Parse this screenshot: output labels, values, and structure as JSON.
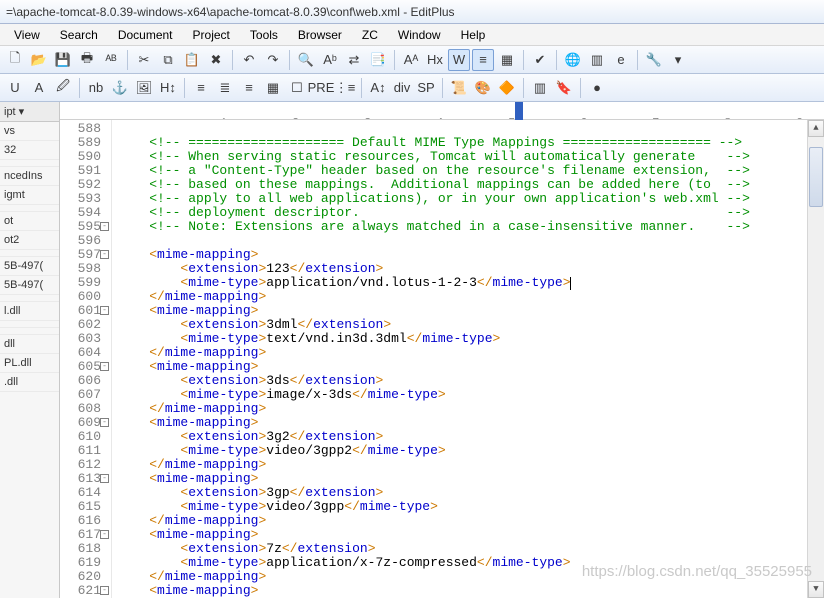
{
  "title": "=\\apache-tomcat-8.0.39-windows-x64\\apache-tomcat-8.0.39\\conf\\web.xml - EditPlus",
  "menu": [
    "View",
    "Search",
    "Document",
    "Project",
    "Tools",
    "Browser",
    "ZC",
    "Window",
    "Help"
  ],
  "sidebar": {
    "tab": "ipt ▾",
    "items": [
      "vs",
      "32",
      "",
      "ncedIns",
      "igmt",
      "",
      "ot",
      "ot2",
      "",
      "5B-497(",
      "5B-497(",
      "",
      "l.dll",
      "",
      "",
      "dll",
      "PL.dll",
      ".dll"
    ]
  },
  "ruler": "----+----1----+----2----+----3----+----4----+----5----+----6----+----7----+----8----+----9----+----0-",
  "ruler_mark_col": 56,
  "watermark": "https://blog.csdn.net/qq_35525955",
  "lines": [
    {
      "n": 588,
      "c": ""
    },
    {
      "n": 589,
      "c": "    <!-- ==================== Default MIME Type Mappings =================== -->",
      "cls": "cm"
    },
    {
      "n": 590,
      "c": "    <!-- When serving static resources, Tomcat will automatically generate    -->",
      "cls": "cm"
    },
    {
      "n": 591,
      "c": "    <!-- a \"Content-Type\" header based on the resource's filename extension,  -->",
      "cls": "cm"
    },
    {
      "n": 592,
      "c": "    <!-- based on these mappings.  Additional mappings can be added here (to  -->",
      "cls": "cm"
    },
    {
      "n": 593,
      "c": "    <!-- apply to all web applications), or in your own application's web.xml -->",
      "cls": "cm"
    },
    {
      "n": 594,
      "c": "    <!-- deployment descriptor.                                               -->",
      "cls": "cm"
    },
    {
      "n": 595,
      "c": "    <!-- Note: Extensions are always matched in a case-insensitive manner.    -->",
      "cls": "cm",
      "fold": "-"
    },
    {
      "n": 596,
      "c": ""
    },
    {
      "n": 597,
      "seg": [
        [
          "    ",
          ""
        ],
        [
          "<",
          "br"
        ],
        [
          "mime-mapping",
          "tag"
        ],
        [
          ">",
          "br"
        ]
      ],
      "fold": "-"
    },
    {
      "n": 598,
      "seg": [
        [
          "        ",
          ""
        ],
        [
          "<",
          "br"
        ],
        [
          "extension",
          "tag"
        ],
        [
          ">",
          "br"
        ],
        [
          "123",
          "txt"
        ],
        [
          "</",
          "br"
        ],
        [
          "extension",
          "tag"
        ],
        [
          ">",
          "br"
        ]
      ]
    },
    {
      "n": 599,
      "seg": [
        [
          "        ",
          ""
        ],
        [
          "<",
          "br"
        ],
        [
          "mime-type",
          "tag"
        ],
        [
          ">",
          "br"
        ],
        [
          "application/vnd.lotus-1-2-3",
          "txt"
        ],
        [
          "</",
          "br"
        ],
        [
          "mime-type",
          "tag"
        ],
        [
          ">",
          "br"
        ]
      ],
      "caret": true,
      "arrow": true
    },
    {
      "n": 600,
      "seg": [
        [
          "    ",
          ""
        ],
        [
          "</",
          "br"
        ],
        [
          "mime-mapping",
          "tag"
        ],
        [
          ">",
          "br"
        ]
      ]
    },
    {
      "n": 601,
      "seg": [
        [
          "    ",
          ""
        ],
        [
          "<",
          "br"
        ],
        [
          "mime-mapping",
          "tag"
        ],
        [
          ">",
          "br"
        ]
      ],
      "fold": "-"
    },
    {
      "n": 602,
      "seg": [
        [
          "        ",
          ""
        ],
        [
          "<",
          "br"
        ],
        [
          "extension",
          "tag"
        ],
        [
          ">",
          "br"
        ],
        [
          "3dml",
          "txt"
        ],
        [
          "</",
          "br"
        ],
        [
          "extension",
          "tag"
        ],
        [
          ">",
          "br"
        ]
      ]
    },
    {
      "n": 603,
      "seg": [
        [
          "        ",
          ""
        ],
        [
          "<",
          "br"
        ],
        [
          "mime-type",
          "tag"
        ],
        [
          ">",
          "br"
        ],
        [
          "text/vnd.in3d.3dml",
          "txt"
        ],
        [
          "</",
          "br"
        ],
        [
          "mime-type",
          "tag"
        ],
        [
          ">",
          "br"
        ]
      ]
    },
    {
      "n": 604,
      "seg": [
        [
          "    ",
          ""
        ],
        [
          "</",
          "br"
        ],
        [
          "mime-mapping",
          "tag"
        ],
        [
          ">",
          "br"
        ]
      ]
    },
    {
      "n": 605,
      "seg": [
        [
          "    ",
          ""
        ],
        [
          "<",
          "br"
        ],
        [
          "mime-mapping",
          "tag"
        ],
        [
          ">",
          "br"
        ]
      ],
      "fold": "-"
    },
    {
      "n": 606,
      "seg": [
        [
          "        ",
          ""
        ],
        [
          "<",
          "br"
        ],
        [
          "extension",
          "tag"
        ],
        [
          ">",
          "br"
        ],
        [
          "3ds",
          "txt"
        ],
        [
          "</",
          "br"
        ],
        [
          "extension",
          "tag"
        ],
        [
          ">",
          "br"
        ]
      ]
    },
    {
      "n": 607,
      "seg": [
        [
          "        ",
          ""
        ],
        [
          "<",
          "br"
        ],
        [
          "mime-type",
          "tag"
        ],
        [
          ">",
          "br"
        ],
        [
          "image/x-3ds",
          "txt"
        ],
        [
          "</",
          "br"
        ],
        [
          "mime-type",
          "tag"
        ],
        [
          ">",
          "br"
        ]
      ]
    },
    {
      "n": 608,
      "seg": [
        [
          "    ",
          ""
        ],
        [
          "</",
          "br"
        ],
        [
          "mime-mapping",
          "tag"
        ],
        [
          ">",
          "br"
        ]
      ]
    },
    {
      "n": 609,
      "seg": [
        [
          "    ",
          ""
        ],
        [
          "<",
          "br"
        ],
        [
          "mime-mapping",
          "tag"
        ],
        [
          ">",
          "br"
        ]
      ],
      "fold": "-"
    },
    {
      "n": 610,
      "seg": [
        [
          "        ",
          ""
        ],
        [
          "<",
          "br"
        ],
        [
          "extension",
          "tag"
        ],
        [
          ">",
          "br"
        ],
        [
          "3g2",
          "txt"
        ],
        [
          "</",
          "br"
        ],
        [
          "extension",
          "tag"
        ],
        [
          ">",
          "br"
        ]
      ]
    },
    {
      "n": 611,
      "seg": [
        [
          "        ",
          ""
        ],
        [
          "<",
          "br"
        ],
        [
          "mime-type",
          "tag"
        ],
        [
          ">",
          "br"
        ],
        [
          "video/3gpp2",
          "txt"
        ],
        [
          "</",
          "br"
        ],
        [
          "mime-type",
          "tag"
        ],
        [
          ">",
          "br"
        ]
      ]
    },
    {
      "n": 612,
      "seg": [
        [
          "    ",
          ""
        ],
        [
          "</",
          "br"
        ],
        [
          "mime-mapping",
          "tag"
        ],
        [
          ">",
          "br"
        ]
      ]
    },
    {
      "n": 613,
      "seg": [
        [
          "    ",
          ""
        ],
        [
          "<",
          "br"
        ],
        [
          "mime-mapping",
          "tag"
        ],
        [
          ">",
          "br"
        ]
      ],
      "fold": "-"
    },
    {
      "n": 614,
      "seg": [
        [
          "        ",
          ""
        ],
        [
          "<",
          "br"
        ],
        [
          "extension",
          "tag"
        ],
        [
          ">",
          "br"
        ],
        [
          "3gp",
          "txt"
        ],
        [
          "</",
          "br"
        ],
        [
          "extension",
          "tag"
        ],
        [
          ">",
          "br"
        ]
      ]
    },
    {
      "n": 615,
      "seg": [
        [
          "        ",
          ""
        ],
        [
          "<",
          "br"
        ],
        [
          "mime-type",
          "tag"
        ],
        [
          ">",
          "br"
        ],
        [
          "video/3gpp",
          "txt"
        ],
        [
          "</",
          "br"
        ],
        [
          "mime-type",
          "tag"
        ],
        [
          ">",
          "br"
        ]
      ]
    },
    {
      "n": 616,
      "seg": [
        [
          "    ",
          ""
        ],
        [
          "</",
          "br"
        ],
        [
          "mime-mapping",
          "tag"
        ],
        [
          ">",
          "br"
        ]
      ]
    },
    {
      "n": 617,
      "seg": [
        [
          "    ",
          ""
        ],
        [
          "<",
          "br"
        ],
        [
          "mime-mapping",
          "tag"
        ],
        [
          ">",
          "br"
        ]
      ],
      "fold": "-"
    },
    {
      "n": 618,
      "seg": [
        [
          "        ",
          ""
        ],
        [
          "<",
          "br"
        ],
        [
          "extension",
          "tag"
        ],
        [
          ">",
          "br"
        ],
        [
          "7z",
          "txt"
        ],
        [
          "</",
          "br"
        ],
        [
          "extension",
          "tag"
        ],
        [
          ">",
          "br"
        ]
      ]
    },
    {
      "n": 619,
      "seg": [
        [
          "        ",
          ""
        ],
        [
          "<",
          "br"
        ],
        [
          "mime-type",
          "tag"
        ],
        [
          ">",
          "br"
        ],
        [
          "application/x-7z-compressed",
          "txt"
        ],
        [
          "</",
          "br"
        ],
        [
          "mime-type",
          "tag"
        ],
        [
          ">",
          "br"
        ]
      ]
    },
    {
      "n": 620,
      "seg": [
        [
          "    ",
          ""
        ],
        [
          "</",
          "br"
        ],
        [
          "mime-mapping",
          "tag"
        ],
        [
          ">",
          "br"
        ]
      ]
    },
    {
      "n": 621,
      "seg": [
        [
          "    ",
          ""
        ],
        [
          "<",
          "br"
        ],
        [
          "mime-mapping",
          "tag"
        ],
        [
          ">",
          "br"
        ]
      ],
      "fold": "-"
    }
  ],
  "toolbar1": [
    {
      "name": "new-file-icon",
      "g": "🗋"
    },
    {
      "name": "open-icon",
      "g": "📂"
    },
    {
      "name": "save-icon",
      "g": "💾"
    },
    {
      "name": "print-icon",
      "g": "🖶"
    },
    {
      "name": "spell-icon",
      "g": "ᴬᴮ"
    },
    {
      "sep": true
    },
    {
      "name": "cut-icon",
      "g": "✂"
    },
    {
      "name": "copy-icon",
      "g": "⧉"
    },
    {
      "name": "paste-icon",
      "g": "📋"
    },
    {
      "name": "delete-icon",
      "g": "✖"
    },
    {
      "sep": true
    },
    {
      "name": "undo-icon",
      "g": "↶"
    },
    {
      "name": "redo-icon",
      "g": "↷"
    },
    {
      "sep": true
    },
    {
      "name": "find-icon",
      "g": "🔍"
    },
    {
      "name": "find-next-icon",
      "g": "Aᵇ"
    },
    {
      "name": "replace-icon",
      "g": "⇄"
    },
    {
      "name": "find-in-files-icon",
      "g": "📑"
    },
    {
      "sep": true
    },
    {
      "name": "font-size-icon",
      "g": "Aᴬ"
    },
    {
      "name": "hex-icon",
      "g": "Hx"
    },
    {
      "name": "word-wrap-icon",
      "g": "W",
      "active": true
    },
    {
      "name": "line-number-icon",
      "g": "≡",
      "active": true
    },
    {
      "name": "column-marker-icon",
      "g": "▦"
    },
    {
      "sep": true
    },
    {
      "name": "spell-check-icon",
      "g": "✔"
    },
    {
      "sep": true
    },
    {
      "name": "browser-icon",
      "g": "🌐"
    },
    {
      "name": "preview-icon",
      "g": "▥"
    },
    {
      "name": "ie-icon",
      "g": "e"
    },
    {
      "sep": true
    },
    {
      "name": "tools-icon",
      "g": "🔧"
    },
    {
      "name": "dropdown-icon",
      "g": "▾"
    }
  ],
  "toolbar2": [
    {
      "name": "underline-icon",
      "g": "U"
    },
    {
      "name": "font-color-icon",
      "g": "A"
    },
    {
      "name": "highlight-icon",
      "g": "🖉"
    },
    {
      "sep": true
    },
    {
      "name": "nbsp-icon",
      "g": "nb"
    },
    {
      "name": "anchor-icon",
      "g": "⚓"
    },
    {
      "name": "image-icon",
      "g": "🖼"
    },
    {
      "name": "heading-icon",
      "g": "H↕"
    },
    {
      "sep": true
    },
    {
      "name": "align-left-icon",
      "g": "≡"
    },
    {
      "name": "align-center-icon",
      "g": "≣"
    },
    {
      "name": "align-right-icon",
      "g": "≡"
    },
    {
      "name": "table-icon",
      "g": "▦"
    },
    {
      "name": "form-icon",
      "g": "☐"
    },
    {
      "name": "pre-icon",
      "g": "PRE"
    },
    {
      "name": "list-icon",
      "g": "⋮≡"
    },
    {
      "sep": true
    },
    {
      "name": "char-icon",
      "g": "A↕"
    },
    {
      "name": "div-icon",
      "g": "div"
    },
    {
      "name": "span-icon",
      "g": "SP"
    },
    {
      "sep": true
    },
    {
      "name": "script-icon",
      "g": "📜"
    },
    {
      "name": "css-icon",
      "g": "🎨"
    },
    {
      "name": "object-icon",
      "g": "🔶"
    },
    {
      "sep": true
    },
    {
      "name": "column-select-icon",
      "g": "▥"
    },
    {
      "name": "bookmark-icon",
      "g": "🔖"
    },
    {
      "sep": true
    },
    {
      "name": "record-icon",
      "g": "●"
    }
  ]
}
